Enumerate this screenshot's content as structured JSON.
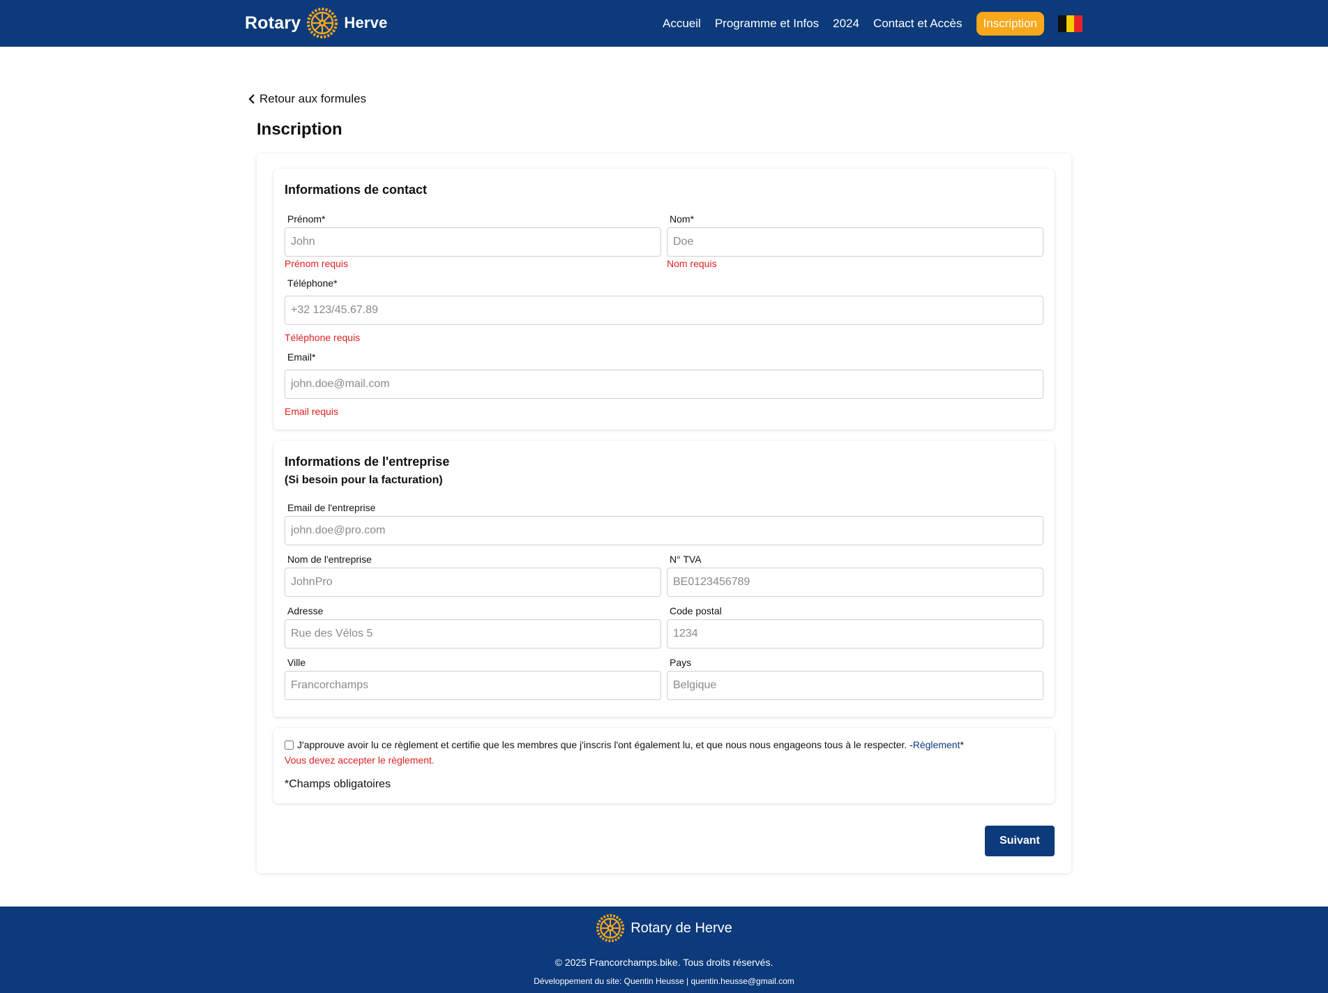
{
  "header": {
    "brand_left": "Rotary",
    "brand_right": "Herve",
    "nav": [
      "Accueil",
      "Programme et Infos",
      "2024",
      "Contact et Accès"
    ],
    "cta": "Inscription",
    "flag_colors": [
      "#111111",
      "#f5d000",
      "#e8232b"
    ]
  },
  "main": {
    "back_link": "Retour aux formules",
    "title": "Inscription",
    "contact": {
      "title": "Informations de contact",
      "firstname": {
        "label": "Prénom*",
        "placeholder": "John",
        "error": "Prénom requis"
      },
      "lastname": {
        "label": "Nom*",
        "placeholder": "Doe",
        "error": "Nom requis"
      },
      "phone": {
        "label": "Téléphone*",
        "placeholder": "+32 123/45.67.89",
        "error": "Téléphone requis"
      },
      "email": {
        "label": "Email*",
        "placeholder": "john.doe@mail.com",
        "error": "Email requis"
      }
    },
    "company": {
      "title": "Informations de l'entreprise",
      "subtitle": "(Si besoin pour la facturation)",
      "email": {
        "label": "Email de l'entreprise",
        "placeholder": "john.doe@pro.com"
      },
      "name": {
        "label": "Nom de l'entreprise",
        "placeholder": "JohnPro"
      },
      "vat": {
        "label": "N° TVA",
        "placeholder": "BE0123456789"
      },
      "address": {
        "label": "Adresse",
        "placeholder": "Rue des Vélos 5"
      },
      "zip": {
        "label": "Code postal",
        "placeholder": "1234"
      },
      "city": {
        "label": "Ville",
        "placeholder": "Francorchamps"
      },
      "country": {
        "label": "Pays",
        "placeholder": "Belgique"
      }
    },
    "agreement": {
      "text": "J'approuve avoir lu ce règlement et certifie que les membres que j'inscris l'ont également lu, et que nous nous engageons tous à le respecter. - ",
      "link": "Règlement",
      "asterisk": "*",
      "error": "Vous devez accepter le règlement.",
      "required_note": "*Champs obligatoires"
    },
    "next_button": "Suivant"
  },
  "footer": {
    "brand": "Rotary de Herve",
    "copyright": "© 2025 Francorchamps.bike. Tous droits réservés.",
    "developer": "Développement du site: Quentin Heusse | quentin.heusse@gmail.com"
  },
  "colors": {
    "primary": "#0c3a7b",
    "accent": "#f7a81b",
    "error": "#e02020"
  }
}
